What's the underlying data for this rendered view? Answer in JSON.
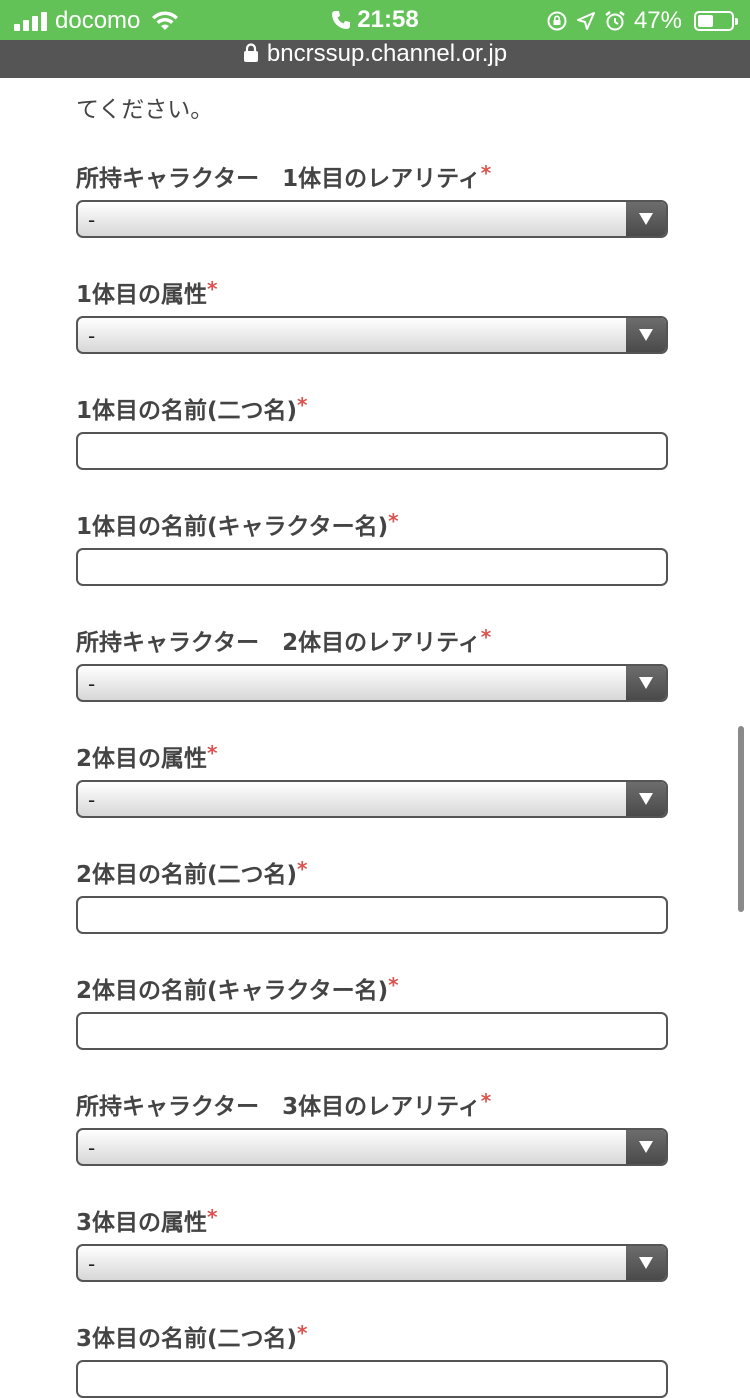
{
  "status_bar": {
    "carrier": "docomo",
    "time": "21:58",
    "battery": "47%",
    "battery_level": 0.47
  },
  "url_bar": {
    "domain": "bncrssup.channel.or.jp"
  },
  "intro_text": "てください。",
  "required_mark": "*",
  "fields": [
    {
      "label": "所持キャラクター　1体目のレアリティ",
      "type": "select",
      "value": "-"
    },
    {
      "label": "1体目の属性",
      "type": "select",
      "value": "-"
    },
    {
      "label": "1体目の名前(二つ名)",
      "type": "text",
      "value": ""
    },
    {
      "label": "1体目の名前(キャラクター名)",
      "type": "text",
      "value": ""
    },
    {
      "label": "所持キャラクター　2体目のレアリティ",
      "type": "select",
      "value": "-"
    },
    {
      "label": "2体目の属性",
      "type": "select",
      "value": "-"
    },
    {
      "label": "2体目の名前(二つ名)",
      "type": "text",
      "value": ""
    },
    {
      "label": "2体目の名前(キャラクター名)",
      "type": "text",
      "value": ""
    },
    {
      "label": "所持キャラクター　3体目のレアリティ",
      "type": "select",
      "value": "-"
    },
    {
      "label": "3体目の属性",
      "type": "select",
      "value": "-"
    },
    {
      "label": "3体目の名前(二つ名)",
      "type": "text",
      "value": ""
    }
  ],
  "colors": {
    "status_bar": "#62c257",
    "url_bar": "#555555",
    "required": "#d9534f"
  }
}
